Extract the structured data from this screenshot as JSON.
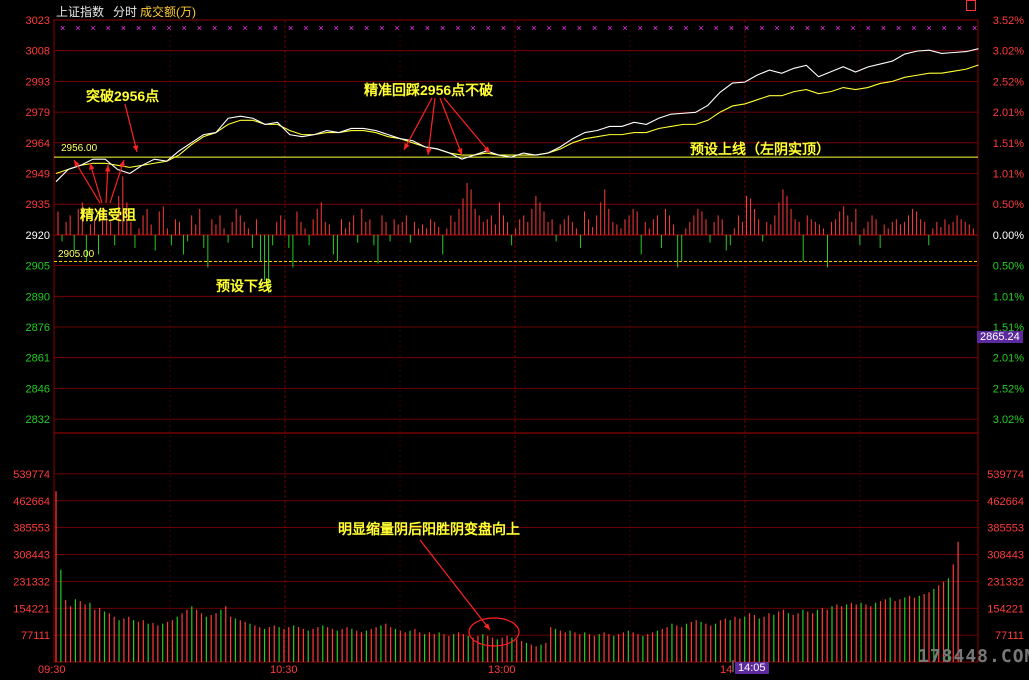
{
  "header": {
    "symbol": "上证指数",
    "mode": "分时",
    "indicator": "成交额(万)"
  },
  "colors": {
    "up": "#ff3b3b",
    "down": "#22cc22",
    "flat": "#ffffff",
    "annotation": "#ffff33",
    "grid": "#8a0000",
    "avg": "#ffff33",
    "marker": "#ff33ff",
    "badge": "#5c2a9e",
    "watermark": "#777777"
  },
  "annotations": {
    "breakout": "突破2956点",
    "resisted": "精准受阻",
    "pullback": "精准回踩2956点不破",
    "upper_line": "预设上线（左阴实顶）",
    "lower_line": "预设下线",
    "volume_note": "明显缩量阴后阳胜阴变盘向上"
  },
  "levels": {
    "upper_label": "2956.00",
    "lower_label": "2905.00",
    "upper": 2956.0,
    "lower": 2905.0
  },
  "crosshair": {
    "price_label": "2865.24",
    "time_label": "14:05"
  },
  "watermark": "178448.COM",
  "chart_data": {
    "type": "line",
    "price_axis": {
      "ticks": [
        "3023",
        "3008",
        "2993",
        "2979",
        "2964",
        "2949",
        "2935",
        "2920",
        "2905",
        "2890",
        "2876",
        "2861",
        "2846",
        "2832"
      ],
      "tick_values": [
        3023,
        3008,
        2993,
        2979,
        2964,
        2949,
        2935,
        2920,
        2905,
        2890,
        2876,
        2861,
        2846,
        2832
      ],
      "pct_ticks": [
        "3.52%",
        "3.02%",
        "2.52%",
        "2.01%",
        "1.51%",
        "1.01%",
        "0.50%",
        "0.00%",
        "0.50%",
        "1.01%",
        "1.51%",
        "2.01%",
        "2.52%",
        "3.02%"
      ],
      "prev_close": 2920
    },
    "volume_axis": {
      "ticks": [
        "539774",
        "462664",
        "385553",
        "308443",
        "231332",
        "154221",
        "77111"
      ],
      "tick_values": [
        539774,
        462664,
        385553,
        308443,
        231332,
        154221,
        77111
      ],
      "max": 617000
    },
    "time_axis": [
      "09:30",
      "10:30",
      "13:00",
      "14"
    ],
    "price_line": [
      [
        0,
        2944
      ],
      [
        3,
        2950
      ],
      [
        6,
        2952
      ],
      [
        9,
        2955
      ],
      [
        12,
        2955
      ],
      [
        15,
        2950
      ],
      [
        18,
        2948
      ],
      [
        21,
        2952
      ],
      [
        24,
        2955
      ],
      [
        27,
        2954
      ],
      [
        30,
        2959
      ],
      [
        33,
        2963
      ],
      [
        36,
        2967
      ],
      [
        39,
        2968
      ],
      [
        42,
        2975
      ],
      [
        45,
        2976
      ],
      [
        48,
        2975
      ],
      [
        51,
        2972
      ],
      [
        54,
        2973
      ],
      [
        57,
        2967
      ],
      [
        60,
        2966
      ],
      [
        63,
        2967
      ],
      [
        66,
        2969
      ],
      [
        69,
        2968
      ],
      [
        72,
        2970
      ],
      [
        75,
        2970
      ],
      [
        78,
        2969
      ],
      [
        81,
        2967
      ],
      [
        84,
        2965
      ],
      [
        87,
        2964
      ],
      [
        90,
        2961
      ],
      [
        93,
        2960
      ],
      [
        96,
        2958
      ],
      [
        99,
        2955
      ],
      [
        102,
        2957
      ],
      [
        105,
        2959
      ],
      [
        108,
        2957
      ],
      [
        111,
        2956
      ],
      [
        114,
        2958
      ],
      [
        117,
        2957
      ],
      [
        120,
        2958
      ],
      [
        123,
        2961
      ],
      [
        126,
        2965
      ],
      [
        129,
        2968
      ],
      [
        132,
        2969
      ],
      [
        135,
        2971
      ],
      [
        138,
        2971
      ],
      [
        141,
        2973
      ],
      [
        144,
        2972
      ],
      [
        147,
        2975
      ],
      [
        150,
        2977
      ],
      [
        153,
        2978
      ],
      [
        156,
        2979
      ],
      [
        159,
        2983
      ],
      [
        162,
        2990
      ],
      [
        165,
        2995
      ],
      [
        168,
        2996
      ],
      [
        171,
        3000
      ],
      [
        174,
        3003
      ],
      [
        177,
        3002
      ],
      [
        180,
        3005
      ],
      [
        183,
        3007
      ],
      [
        186,
        3002
      ],
      [
        189,
        3005
      ],
      [
        192,
        3008
      ],
      [
        195,
        3006
      ],
      [
        198,
        3009
      ],
      [
        201,
        3011
      ],
      [
        204,
        3013
      ],
      [
        207,
        3017
      ],
      [
        210,
        3019
      ],
      [
        213,
        3020
      ],
      [
        216,
        3019
      ],
      [
        219,
        3020
      ],
      [
        222,
        3021
      ],
      [
        225,
        3023
      ]
    ],
    "avg_line": [
      [
        0,
        2948
      ],
      [
        3,
        2950
      ],
      [
        6,
        2952
      ],
      [
        9,
        2953
      ],
      [
        12,
        2953
      ],
      [
        15,
        2952
      ],
      [
        18,
        2951
      ],
      [
        21,
        2952
      ],
      [
        24,
        2953
      ],
      [
        27,
        2954
      ],
      [
        30,
        2957
      ],
      [
        33,
        2962
      ],
      [
        36,
        2966
      ],
      [
        39,
        2968
      ],
      [
        42,
        2972
      ],
      [
        45,
        2974
      ],
      [
        48,
        2974
      ],
      [
        51,
        2972
      ],
      [
        54,
        2972
      ],
      [
        57,
        2969
      ],
      [
        60,
        2967
      ],
      [
        63,
        2967
      ],
      [
        66,
        2968
      ],
      [
        69,
        2968
      ],
      [
        72,
        2969
      ],
      [
        75,
        2969
      ],
      [
        78,
        2968
      ],
      [
        81,
        2966
      ],
      [
        84,
        2965
      ],
      [
        87,
        2963
      ],
      [
        90,
        2961
      ],
      [
        93,
        2960
      ],
      [
        96,
        2958
      ],
      [
        99,
        2957
      ],
      [
        102,
        2957
      ],
      [
        105,
        2958
      ],
      [
        108,
        2957
      ],
      [
        111,
        2957
      ],
      [
        114,
        2957
      ],
      [
        117,
        2957
      ],
      [
        120,
        2958
      ],
      [
        123,
        2960
      ],
      [
        126,
        2963
      ],
      [
        129,
        2965
      ],
      [
        132,
        2966
      ],
      [
        135,
        2967
      ],
      [
        138,
        2967
      ],
      [
        141,
        2968
      ],
      [
        144,
        2968
      ],
      [
        147,
        2970
      ],
      [
        150,
        2971
      ],
      [
        153,
        2972
      ],
      [
        156,
        2972
      ],
      [
        159,
        2974
      ],
      [
        162,
        2978
      ],
      [
        165,
        2981
      ],
      [
        168,
        2982
      ],
      [
        171,
        2984
      ],
      [
        174,
        2986
      ],
      [
        177,
        2986
      ],
      [
        180,
        2988
      ],
      [
        183,
        2989
      ],
      [
        186,
        2987
      ],
      [
        189,
        2988
      ],
      [
        192,
        2990
      ],
      [
        195,
        2989
      ],
      [
        198,
        2990
      ],
      [
        201,
        2992
      ],
      [
        204,
        2993
      ],
      [
        207,
        2995
      ],
      [
        210,
        2996
      ],
      [
        213,
        2997
      ],
      [
        216,
        2997
      ],
      [
        219,
        2998
      ],
      [
        222,
        2999
      ],
      [
        225,
        3001
      ]
    ],
    "pressure": [
      18,
      -5,
      10,
      15,
      -12,
      20,
      25,
      -20,
      8,
      12,
      -15,
      20,
      15,
      10,
      -8,
      30,
      45,
      25,
      10,
      -10,
      5,
      15,
      20,
      8,
      -12,
      18,
      22,
      5,
      -8,
      12,
      10,
      -15,
      -5,
      15,
      8,
      20,
      -10,
      -25,
      12,
      8,
      15,
      5,
      -6,
      10,
      20,
      15,
      10,
      5,
      -10,
      12,
      -20,
      -35,
      -45,
      -8,
      10,
      15,
      12,
      -10,
      -25,
      18,
      10,
      5,
      -8,
      12,
      20,
      25,
      10,
      8,
      -15,
      -20,
      12,
      5,
      10,
      15,
      -6,
      20,
      10,
      12,
      -8,
      -22,
      15,
      10,
      -5,
      12,
      8,
      10,
      15,
      -6,
      10,
      5,
      8,
      5,
      12,
      10,
      6,
      -15,
      5,
      15,
      10,
      20,
      28,
      40,
      35,
      20,
      15,
      10,
      12,
      15,
      8,
      25,
      15,
      10,
      -8,
      5,
      12,
      15,
      10,
      20,
      30,
      25,
      18,
      10,
      12,
      -5,
      8,
      12,
      15,
      10,
      5,
      -10,
      18,
      12,
      6,
      15,
      25,
      35,
      20,
      10,
      8,
      5,
      12,
      15,
      20,
      18,
      -15,
      10,
      5,
      12,
      15,
      -10,
      20,
      15,
      8,
      -25,
      -20,
      5,
      10,
      15,
      20,
      18,
      12,
      -6,
      10,
      15,
      12,
      -12,
      -8,
      5,
      15,
      10,
      30,
      28,
      20,
      12,
      -5,
      10,
      8,
      15,
      25,
      35,
      30,
      20,
      12,
      10,
      -20,
      15,
      12,
      10,
      8,
      5,
      -25,
      10,
      12,
      18,
      22,
      15,
      10,
      20,
      -8,
      5,
      10,
      15,
      12,
      -10,
      8,
      5,
      10,
      12,
      8,
      10,
      15,
      20,
      18,
      12,
      10,
      -8,
      5,
      10,
      6,
      12,
      8,
      10,
      15,
      12,
      10,
      8,
      5,
      10,
      12,
      8,
      10,
      15,
      12,
      10
    ],
    "volume": [
      490,
      265,
      178,
      160,
      180,
      175,
      165,
      170,
      150,
      155,
      145,
      140,
      130,
      120,
      125,
      130,
      120,
      115,
      120,
      110,
      112,
      105,
      110,
      115,
      120,
      130,
      140,
      150,
      160,
      150,
      140,
      130,
      135,
      140,
      150,
      160,
      130,
      125,
      120,
      115,
      110,
      105,
      100,
      95,
      100,
      105,
      100,
      95,
      100,
      105,
      100,
      95,
      90,
      95,
      100,
      105,
      100,
      95,
      90,
      95,
      100,
      95,
      90,
      85,
      90,
      95,
      100,
      105,
      110,
      100,
      95,
      90,
      85,
      90,
      95,
      85,
      80,
      85,
      80,
      85,
      80,
      75,
      80,
      85,
      80,
      75,
      70,
      75,
      80,
      75,
      70,
      65,
      70,
      75,
      70,
      65,
      60,
      55,
      50,
      45,
      50,
      55,
      100,
      95,
      90,
      85,
      90,
      85,
      80,
      85,
      80,
      75,
      80,
      85,
      80,
      75,
      80,
      85,
      90,
      85,
      80,
      75,
      80,
      85,
      90,
      95,
      100,
      110,
      105,
      100,
      110,
      115,
      120,
      115,
      110,
      105,
      110,
      120,
      125,
      120,
      130,
      125,
      130,
      140,
      135,
      125,
      130,
      140,
      135,
      145,
      150,
      140,
      135,
      140,
      150,
      145,
      140,
      150,
      155,
      150,
      160,
      165,
      160,
      165,
      170,
      165,
      170,
      165,
      160,
      170,
      175,
      180,
      185,
      175,
      180,
      185,
      190,
      185,
      190,
      195,
      200,
      210,
      220,
      230,
      240,
      280,
      345
    ]
  }
}
